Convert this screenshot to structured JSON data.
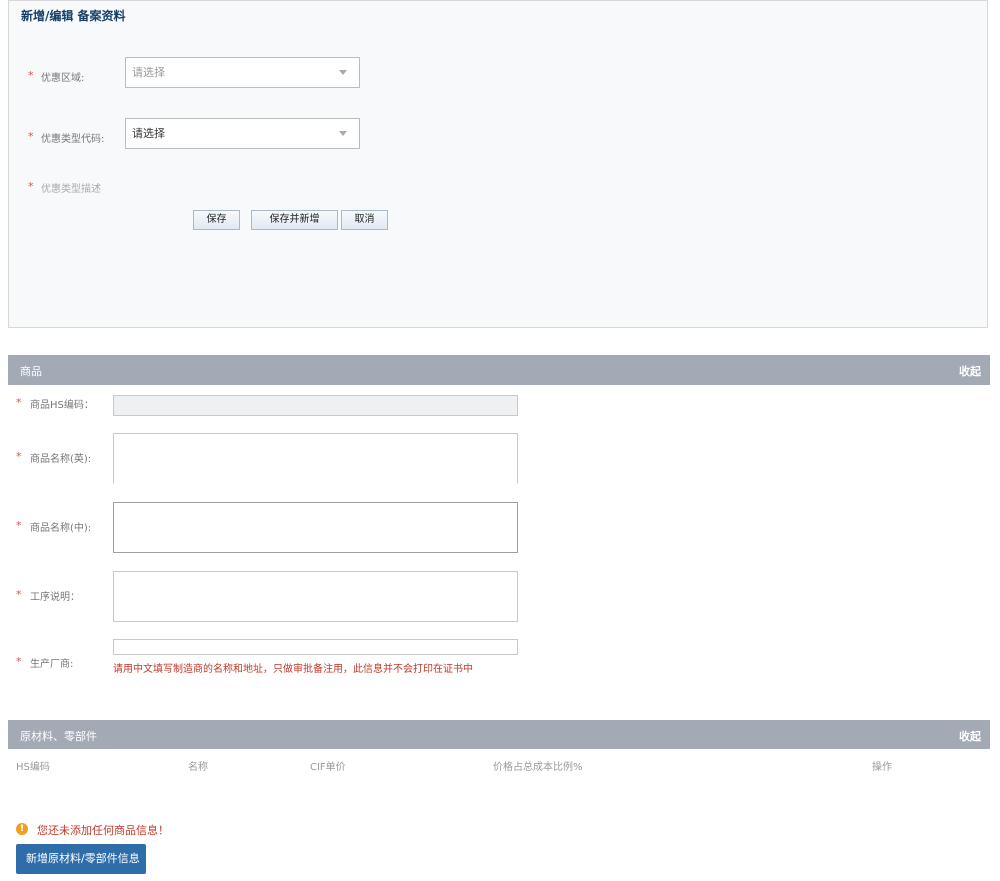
{
  "form": {
    "title": "新增/编辑 备案资料",
    "required_mark": "*",
    "fields": [
      {
        "label": "优惠区域:",
        "placeholder": "请选择"
      },
      {
        "label": "优惠类型代码:",
        "placeholder": "请选择"
      },
      {
        "label": "优惠类型描述"
      }
    ],
    "buttons": {
      "save": "保存",
      "save_add": "保存并新增",
      "cancel": "取消"
    }
  },
  "goods": {
    "section_title": "商品",
    "collapse": "收起",
    "fields": [
      {
        "label": "商品HS编码："
      },
      {
        "label": "商品名称(英):"
      },
      {
        "label": "商品名称(中):"
      },
      {
        "label": "工序说明："
      },
      {
        "label": "生产厂商:"
      }
    ],
    "hint": "请用中文填写制造商的名称和地址，只做审批备注用，此信息并不会打印在证书中"
  },
  "materials": {
    "section_title": "原材料、零部件",
    "collapse": "收起",
    "columns": [
      "HS编码",
      "名称",
      "CIF单价",
      "价格占总成本比例%",
      "操作"
    ],
    "warning": "您还未添加任何商品信息！",
    "add_button": "新增原材料/零部件信息"
  },
  "colors": {
    "accent": "#2f6da8",
    "bar": "#a3a9b5",
    "required": "#d9534f"
  }
}
